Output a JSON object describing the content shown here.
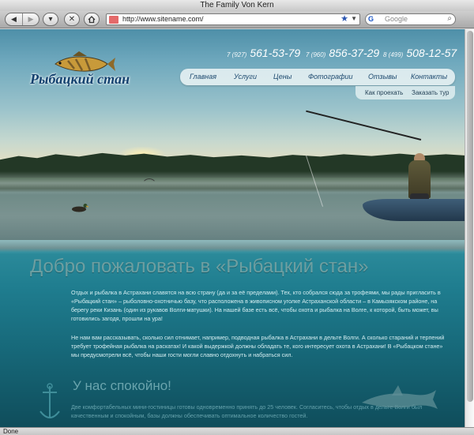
{
  "browser": {
    "title": "The Family Von Kern",
    "url": "http://www.sitename.com/",
    "search_engine": "G",
    "search_placeholder": "Google",
    "status": "Done"
  },
  "site": {
    "logo": "Рыбацкий стан",
    "phones": [
      {
        "code": "7 (927)",
        "number": "561-53-79"
      },
      {
        "code": "7 (960)",
        "number": "856-37-29"
      },
      {
        "code": "8 (499)",
        "number": "508-12-57"
      }
    ],
    "nav": [
      "Главная",
      "Услуги",
      "Цены",
      "Фотографии",
      "Отзывы",
      "Контакты"
    ],
    "subnav": [
      "Как проехать",
      "Заказать тур"
    ]
  },
  "content": {
    "welcome": "Добро пожаловать в «Рыбацкий стан»",
    "para1": "Отдых и рыбалка в Астрахани славятся на всю страну (да и за её пределами). Тех, кто собрался сюда за трофеями, мы рады пригласить в «Рыбацкий стан» – рыболовно-охотничью базу, что расположена в живописном уголке Астраханской области – в Камызякском районе, на берегу реки Кизань (один из рукавов Волги-матушки). На нашей базе есть всё, чтобы охота и рыбалка на Волге, к которой, быть может, вы готовились загодя, прошли на ура!",
    "para2": "Не нам вам рассказывать, сколько сил отнимает, например, подводная рыбалка в Астрахани в дельте Волги. А сколько стараний и терпений требует трофейная рыбалка на раскатах! И какой выдержкой должны обладать те, кого интересует охота в Астрахани! В «Рыбацком стане» мы предусмотрели всё, чтобы наши гости могли славно отдохнуть и набраться сил.",
    "subheading": "У нас спокойно!",
    "para3": "Две комфортабельных мини-гостиницы готовы одновременно принять до 25 человек. Согласитесь, чтобы отдых в дельте Волги был качественным и спокойным, базы должны обеспечивать оптимальное количество гостей."
  }
}
